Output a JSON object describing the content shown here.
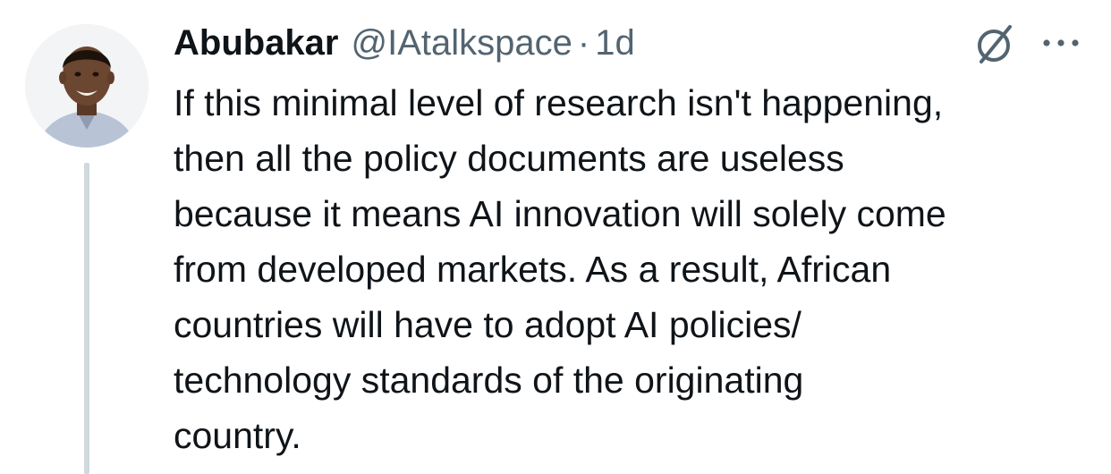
{
  "tweet": {
    "author": {
      "name": "Abubakar",
      "handle": "@IAtalkspace",
      "avatar_icon": "profile-photo"
    },
    "separator": "·",
    "time": "1d",
    "actions": {
      "grok_icon": "grok-slash-icon",
      "more_icon": "ellipsis-icon"
    },
    "text_lines": [
      "If this minimal level of research isn't happening,",
      "then all the policy documents are useless",
      "because it means AI innovation will solely come",
      "from developed markets. As a result, African",
      "countries will have to adopt AI policies/",
      "technology standards of the originating",
      "country."
    ],
    "colors": {
      "primary_text": "#0f1419",
      "secondary_text": "#536471",
      "thread_line": "#cfd9de"
    }
  }
}
